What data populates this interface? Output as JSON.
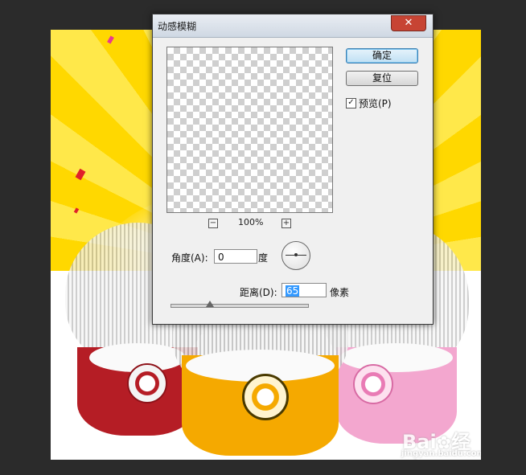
{
  "dialog": {
    "title": "动感模糊",
    "close_icon": "close-icon",
    "zoom": {
      "minus": "−",
      "plus": "+",
      "label": "100%"
    },
    "ok_label": "确定",
    "reset_label": "复位",
    "preview_checkbox": {
      "label": "预览(P)",
      "checked": true,
      "mark": "✓"
    },
    "angle": {
      "label": "角度(A):",
      "value": "0",
      "unit": "度"
    },
    "distance": {
      "label": "距离(D):",
      "value": "65",
      "unit": "像素"
    }
  },
  "colors": {
    "accent": "#3399ff",
    "background_yellow": "#ffd800",
    "red_heater": "#b51d25",
    "yellow_heater": "#f5a900",
    "pink_heater": "#f3a7cf"
  },
  "watermark": {
    "brand": "Bai",
    "text": "经验",
    "url": "jingyan.baidu.com"
  }
}
